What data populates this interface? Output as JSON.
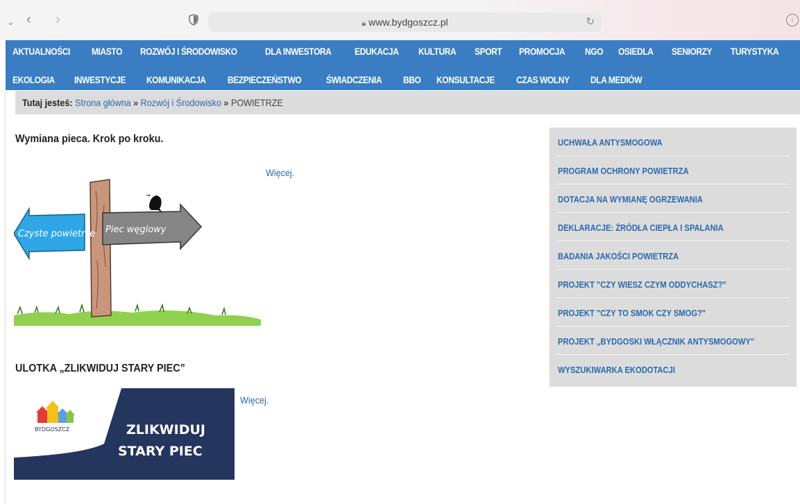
{
  "browser": {
    "url": "www.bydgoszcz.pl"
  },
  "nav": {
    "items": [
      "AKTUALNOŚCI",
      "MIASTO",
      "ROZWÓJ I ŚRODOWISKO",
      "DLA INWESTORA",
      "EDUKACJA",
      "KULTURA",
      "SPORT",
      "PROMOCJA",
      "NGO",
      "OSIEDLA",
      "SENIORZY",
      "TURYSTYKA",
      "EKOLOGIA",
      "INWESTYCJE",
      "KOMUNIKACJA",
      "BEZPIECZEŃSTWO",
      "ŚWIADCZENIA",
      "BBO",
      "KONSULTACJE",
      "CZAS WOLNY",
      "DLA MEDIÓW"
    ]
  },
  "breadcrumb": {
    "label": "Tutaj jesteś:",
    "home": "Strona główna",
    "sep1": "»",
    "section": "Rozwój i Środowisko",
    "sep2": "»",
    "current": "POWIETRZE"
  },
  "main": {
    "article1": {
      "title": "Wymiana pieca. Krok po kroku.",
      "more": "Więcej.",
      "sign_left": "Czyste powietrze",
      "sign_right": "Piec węglowy"
    },
    "article2": {
      "title": "ULOTKA „ZLIKWIDUJ STARY PIEC”",
      "more": "Więcej.",
      "banner_line1": "ZLIKWIDUJ",
      "banner_line2": "STARY PIEC",
      "logo_text": "BYDGOSZCZ"
    }
  },
  "sidebar": {
    "items": [
      "UCHWAŁA ANTYSMOGOWA",
      "PROGRAM OCHRONY POWIETRZA",
      "DOTACJA NA WYMIANĘ OGRZEWANIA",
      "DEKLARACJE: ŹRÓDŁA CIEPŁA I SPALANIA",
      "BADANIA JAKOŚCI POWIETRZA",
      "PROJEKT \"CZY WIESZ CZYM ODDYCHASZ?\"",
      "PROJEKT \"CZY TO SMOK CZY SMOG?\"",
      "PROJEKT „BYDGOSKI WŁĄCZNIK ANTYSMOGOWY\"",
      "WYSZUKIWARKA EKODOTACJI"
    ]
  },
  "colors": {
    "nav_bg": "#3a7dc2",
    "link": "#2a6ab0",
    "panel_bg": "#dcdcdc",
    "banner_navy": "#24355e"
  }
}
